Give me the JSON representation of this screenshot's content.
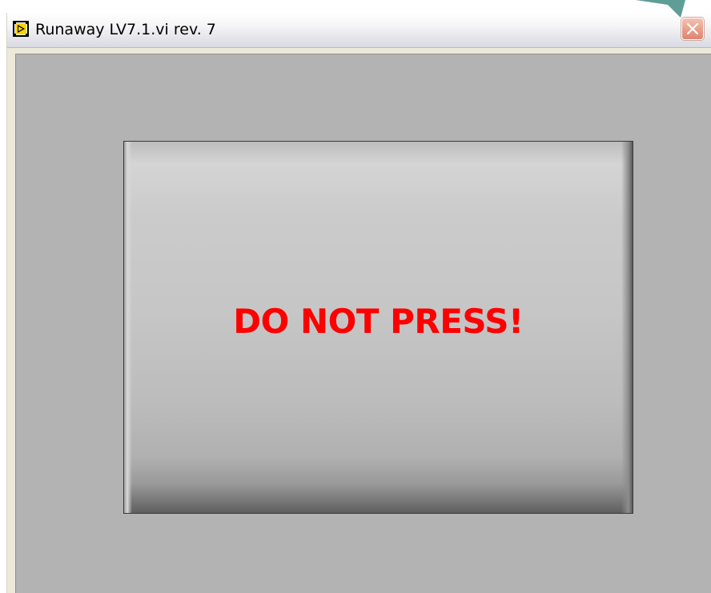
{
  "window": {
    "title": "Runaway LV7.1.vi rev. 7"
  },
  "controls": {
    "stop_button_label": "DO NOT PRESS!"
  },
  "colors": {
    "label_red": "#ff0000",
    "panel_gray": "#b3b3b3",
    "close_button": "#e99d89",
    "pointer_arrow": "#5f9e97"
  },
  "icons": {
    "app_icon": "labview-vi-icon",
    "close_icon": "close-icon",
    "pointer": "arrow-pointer-icon"
  }
}
